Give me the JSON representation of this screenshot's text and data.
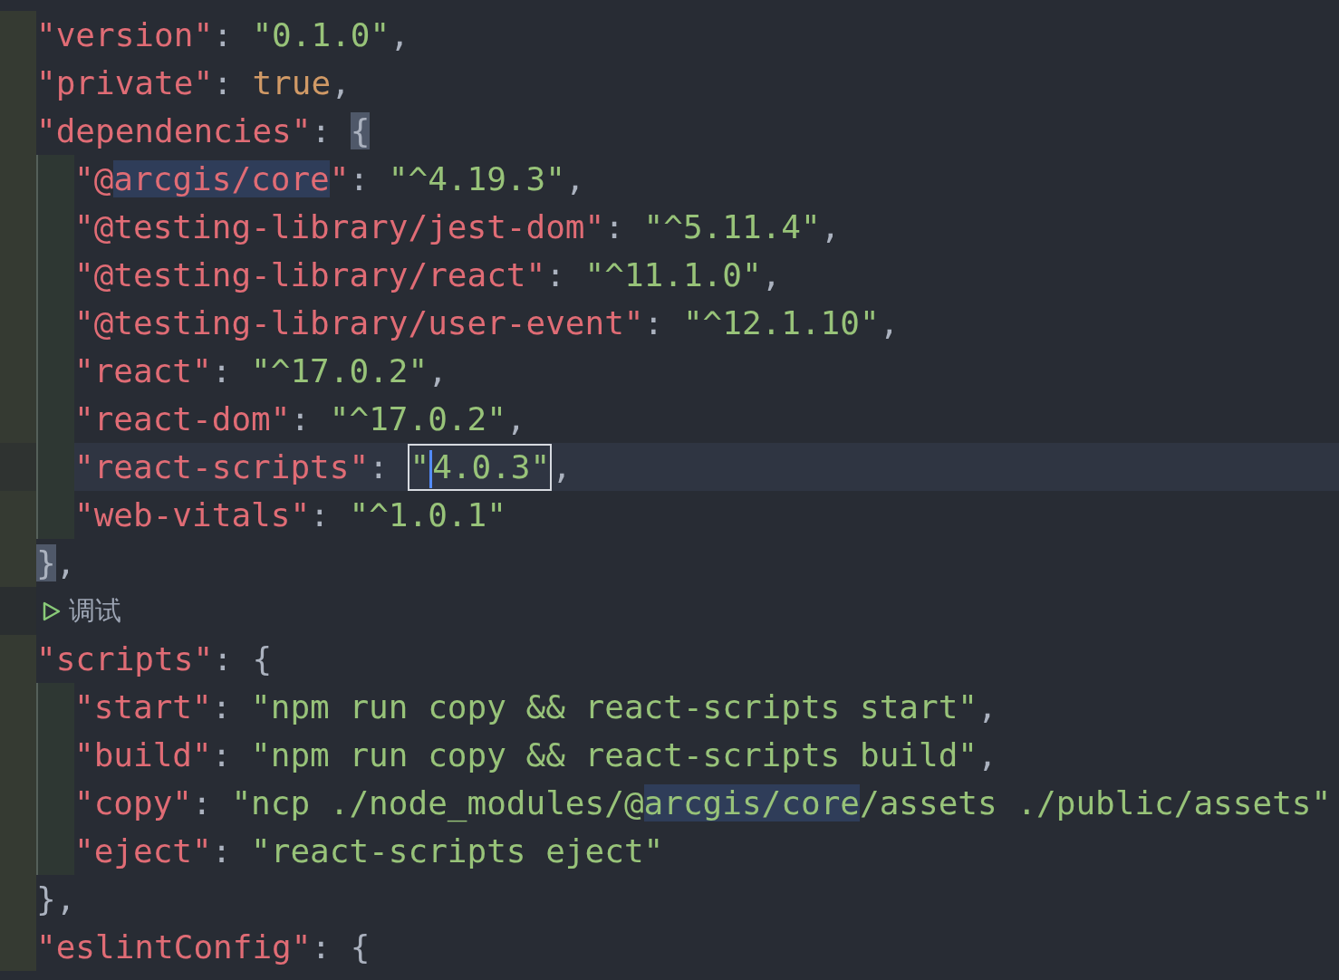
{
  "editor": {
    "lines": [
      {
        "indent": false,
        "current": false,
        "tokens": [
          {
            "kind": "key",
            "text": "\"version\""
          },
          {
            "kind": "punct",
            "text": ": "
          },
          {
            "kind": "string",
            "text": "\"0.1.0\""
          },
          {
            "kind": "punct",
            "text": ","
          }
        ]
      },
      {
        "indent": false,
        "current": false,
        "tokens": [
          {
            "kind": "key",
            "text": "\"private\""
          },
          {
            "kind": "punct",
            "text": ": "
          },
          {
            "kind": "literal",
            "text": "true"
          },
          {
            "kind": "punct",
            "text": ","
          }
        ]
      },
      {
        "indent": false,
        "current": false,
        "tokens": [
          {
            "kind": "key",
            "text": "\"dependencies\""
          },
          {
            "kind": "punct",
            "text": ": "
          },
          {
            "kind": "punct",
            "text": "{",
            "bracket_match": true
          }
        ]
      },
      {
        "indent": true,
        "current": false,
        "tokens": [
          {
            "kind": "key",
            "text": "\"@"
          },
          {
            "kind": "key",
            "text": "arcgis/core",
            "search_match": true
          },
          {
            "kind": "key",
            "text": "\""
          },
          {
            "kind": "punct",
            "text": ": "
          },
          {
            "kind": "string",
            "text": "\"^4.19.3\""
          },
          {
            "kind": "punct",
            "text": ","
          }
        ]
      },
      {
        "indent": true,
        "current": false,
        "tokens": [
          {
            "kind": "key",
            "text": "\"@testing-library/jest-dom\""
          },
          {
            "kind": "punct",
            "text": ": "
          },
          {
            "kind": "string",
            "text": "\"^5.11.4\""
          },
          {
            "kind": "punct",
            "text": ","
          }
        ]
      },
      {
        "indent": true,
        "current": false,
        "tokens": [
          {
            "kind": "key",
            "text": "\"@testing-library/react\""
          },
          {
            "kind": "punct",
            "text": ": "
          },
          {
            "kind": "string",
            "text": "\"^11.1.0\""
          },
          {
            "kind": "punct",
            "text": ","
          }
        ]
      },
      {
        "indent": true,
        "current": false,
        "tokens": [
          {
            "kind": "key",
            "text": "\"@testing-library/user-event\""
          },
          {
            "kind": "punct",
            "text": ": "
          },
          {
            "kind": "string",
            "text": "\"^12.1.10\""
          },
          {
            "kind": "punct",
            "text": ","
          }
        ]
      },
      {
        "indent": true,
        "current": false,
        "tokens": [
          {
            "kind": "key",
            "text": "\"react\""
          },
          {
            "kind": "punct",
            "text": ": "
          },
          {
            "kind": "string",
            "text": "\"^17.0.2\""
          },
          {
            "kind": "punct",
            "text": ","
          }
        ]
      },
      {
        "indent": true,
        "current": false,
        "tokens": [
          {
            "kind": "key",
            "text": "\"react-dom\""
          },
          {
            "kind": "punct",
            "text": ": "
          },
          {
            "kind": "string",
            "text": "\"^17.0.2\""
          },
          {
            "kind": "punct",
            "text": ","
          }
        ]
      },
      {
        "indent": true,
        "current": true,
        "tokens": [
          {
            "kind": "key",
            "text": "\"react-scripts\""
          },
          {
            "kind": "punct",
            "text": ": "
          },
          {
            "kind": "boxed",
            "parts": [
              {
                "kind": "string",
                "text": "\""
              },
              {
                "kind": "cursor"
              },
              {
                "kind": "string",
                "text": "4.0.3\""
              }
            ]
          },
          {
            "kind": "punct",
            "text": ","
          }
        ]
      },
      {
        "indent": true,
        "current": false,
        "tokens": [
          {
            "kind": "key",
            "text": "\"web-vitals\""
          },
          {
            "kind": "punct",
            "text": ": "
          },
          {
            "kind": "string",
            "text": "\"^1.0.1\""
          }
        ]
      },
      {
        "indent": false,
        "current": false,
        "tokens": [
          {
            "kind": "punct",
            "text": "}",
            "bracket_match": true
          },
          {
            "kind": "punct",
            "text": ","
          }
        ]
      },
      {
        "kind": "codelens",
        "text": "调试"
      },
      {
        "indent": false,
        "current": false,
        "tokens": [
          {
            "kind": "key",
            "text": "\"scripts\""
          },
          {
            "kind": "punct",
            "text": ": {"
          }
        ]
      },
      {
        "indent": true,
        "current": false,
        "tokens": [
          {
            "kind": "key",
            "text": "\"start\""
          },
          {
            "kind": "punct",
            "text": ": "
          },
          {
            "kind": "string",
            "text": "\"npm run copy && react-scripts start\""
          },
          {
            "kind": "punct",
            "text": ","
          }
        ]
      },
      {
        "indent": true,
        "current": false,
        "tokens": [
          {
            "kind": "key",
            "text": "\"build\""
          },
          {
            "kind": "punct",
            "text": ": "
          },
          {
            "kind": "string",
            "text": "\"npm run copy && react-scripts build\""
          },
          {
            "kind": "punct",
            "text": ","
          }
        ]
      },
      {
        "indent": true,
        "current": false,
        "tokens": [
          {
            "kind": "key",
            "text": "\"copy\""
          },
          {
            "kind": "punct",
            "text": ": "
          },
          {
            "kind": "string",
            "text": "\"ncp ./node_modules/@"
          },
          {
            "kind": "string",
            "text": "arcgis/core",
            "search_match": true
          },
          {
            "kind": "string",
            "text": "/assets ./public/assets\""
          }
        ]
      },
      {
        "indent": true,
        "current": false,
        "tokens": [
          {
            "kind": "key",
            "text": "\"eject\""
          },
          {
            "kind": "punct",
            "text": ": "
          },
          {
            "kind": "string",
            "text": "\"react-scripts eject\""
          }
        ]
      },
      {
        "indent": false,
        "current": false,
        "tokens": [
          {
            "kind": "punct",
            "text": "},"
          }
        ]
      },
      {
        "indent": false,
        "current": false,
        "tokens": [
          {
            "kind": "key",
            "text": "\"eslintConfig\""
          },
          {
            "kind": "punct",
            "text": ": {"
          }
        ]
      }
    ]
  }
}
